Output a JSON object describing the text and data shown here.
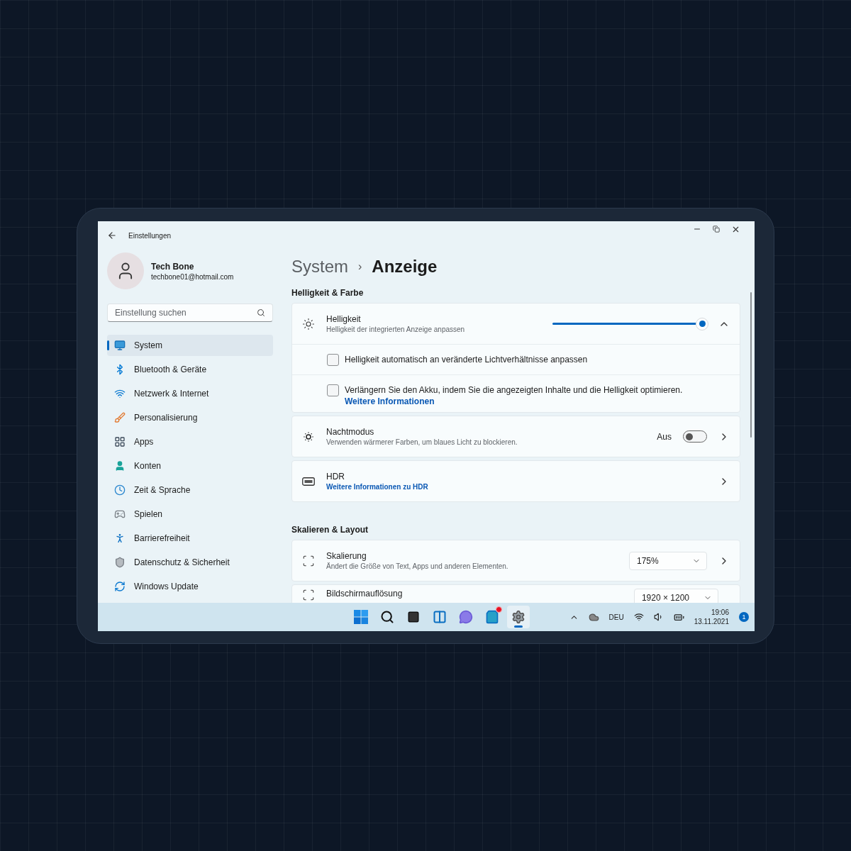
{
  "window": {
    "title": "Einstellungen"
  },
  "user": {
    "name": "Tech Bone",
    "email": "techbone01@hotmail.com"
  },
  "search": {
    "placeholder": "Einstellung suchen"
  },
  "nav": [
    {
      "label": "System",
      "kind": "system",
      "selected": true
    },
    {
      "label": "Bluetooth & Geräte",
      "kind": "bluetooth",
      "selected": false
    },
    {
      "label": "Netzwerk & Internet",
      "kind": "network",
      "selected": false
    },
    {
      "label": "Personalisierung",
      "kind": "brush",
      "selected": false
    },
    {
      "label": "Apps",
      "kind": "apps",
      "selected": false
    },
    {
      "label": "Konten",
      "kind": "account",
      "selected": false
    },
    {
      "label": "Zeit & Sprache",
      "kind": "time",
      "selected": false
    },
    {
      "label": "Spielen",
      "kind": "gaming",
      "selected": false
    },
    {
      "label": "Barrierefreiheit",
      "kind": "accessibility",
      "selected": false
    },
    {
      "label": "Datenschutz & Sicherheit",
      "kind": "privacy",
      "selected": false
    },
    {
      "label": "Windows Update",
      "kind": "update",
      "selected": false
    }
  ],
  "breadcrumb": {
    "parent": "System",
    "separator": "›",
    "current": "Anzeige"
  },
  "sections": [
    {
      "title": "Helligkeit & Farbe",
      "cards": [
        {
          "kind": "slider",
          "title": "Helligkeit",
          "subtitle": "Helligkeit der integrierten Anzeige anpassen",
          "level": 0.97,
          "expanded": true,
          "rows": [
            {
              "text": "Helligkeit automatisch an veränderte Lichtverhältnisse anpassen",
              "checked": false
            },
            {
              "text": "Verlängern Sie den Akku, indem Sie die angezeigten Inhalte und die Helligkeit optimieren.",
              "link": "Weitere Informationen",
              "checked": false
            }
          ]
        },
        {
          "kind": "toggle",
          "title": "Nachtmodus",
          "subtitle": "Verwenden wärmerer Farben, um blaues Licht zu blockieren.",
          "state_label": "Aus",
          "on": false
        },
        {
          "kind": "link",
          "title": "HDR",
          "link": "Weitere Informationen zu HDR"
        }
      ]
    },
    {
      "title": "Skalieren & Layout",
      "cards": [
        {
          "kind": "dropdown",
          "title": "Skalierung",
          "subtitle": "Ändert die Größe von Text, Apps und anderen Elementen.",
          "value": "175%",
          "chevron": true
        },
        {
          "kind": "dropdown",
          "title": "Bildschirmauflösung",
          "value": "1920 × 1200",
          "chevron": false
        }
      ]
    }
  ],
  "taskbar": {
    "apps": [
      {
        "kind": "start",
        "selected": false
      },
      {
        "kind": "search",
        "selected": false
      },
      {
        "kind": "taskview",
        "selected": false
      },
      {
        "kind": "widgets",
        "selected": false
      },
      {
        "kind": "chat",
        "selected": false
      },
      {
        "kind": "store",
        "selected": false,
        "badge": true
      },
      {
        "kind": "settings",
        "selected": true
      }
    ],
    "language": "DEU",
    "time": "19:06",
    "date": "13.11.2021",
    "notifications": "1"
  }
}
